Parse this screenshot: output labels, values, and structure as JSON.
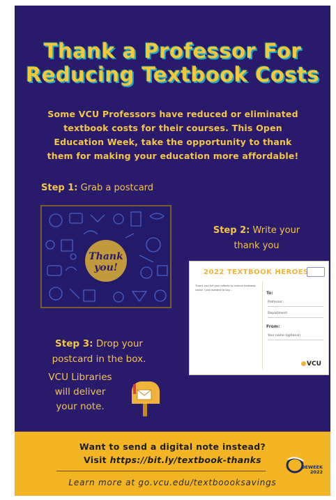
{
  "title": {
    "line1": "Thank a Professor For",
    "line2": "Reducing Textbook Costs"
  },
  "intro": {
    "line1": "Some VCU Professors have reduced or eliminated",
    "line2": "textbook costs for their courses. This Open",
    "line3": "Education Week, take the opportunity to thank",
    "line4": "them for making your education more affordable!"
  },
  "step1": {
    "label": "Step 1:",
    "text": "Grab a postcard",
    "postcard_text": "Thank you!"
  },
  "step2": {
    "label": "Step 2:",
    "text1": "Write your",
    "text2": "thank you"
  },
  "postcard_back": {
    "heading": "2022 TEXTBOOK HEROES",
    "body": "Thank you for your efforts to reduce textbook costs! I just wanted to say...",
    "to": "To:",
    "professor": "Professor:",
    "department": "Department:",
    "from": "From:",
    "your_name": "Your name (optional)",
    "vcu": "VCU"
  },
  "step3": {
    "label": "Step 3:",
    "text1": "Drop your",
    "text2": "postcard in the box.",
    "lib1": "VCU Libraries",
    "lib2": "will deliver",
    "lib3": "your note."
  },
  "footer": {
    "question": "Want to send a digital note instead?",
    "visit": "Visit",
    "link": "https://bit.ly/textbook-thanks",
    "learn": "Learn more at go.vcu.edu/textboooksavings",
    "logo_text": "OEWEEK",
    "logo_year": "2022"
  },
  "colors": {
    "background": "#2a1a6b",
    "accent_yellow": "#f3c64a",
    "footer_bg": "#f3b524",
    "title_shadow": "#1aa9c9"
  }
}
